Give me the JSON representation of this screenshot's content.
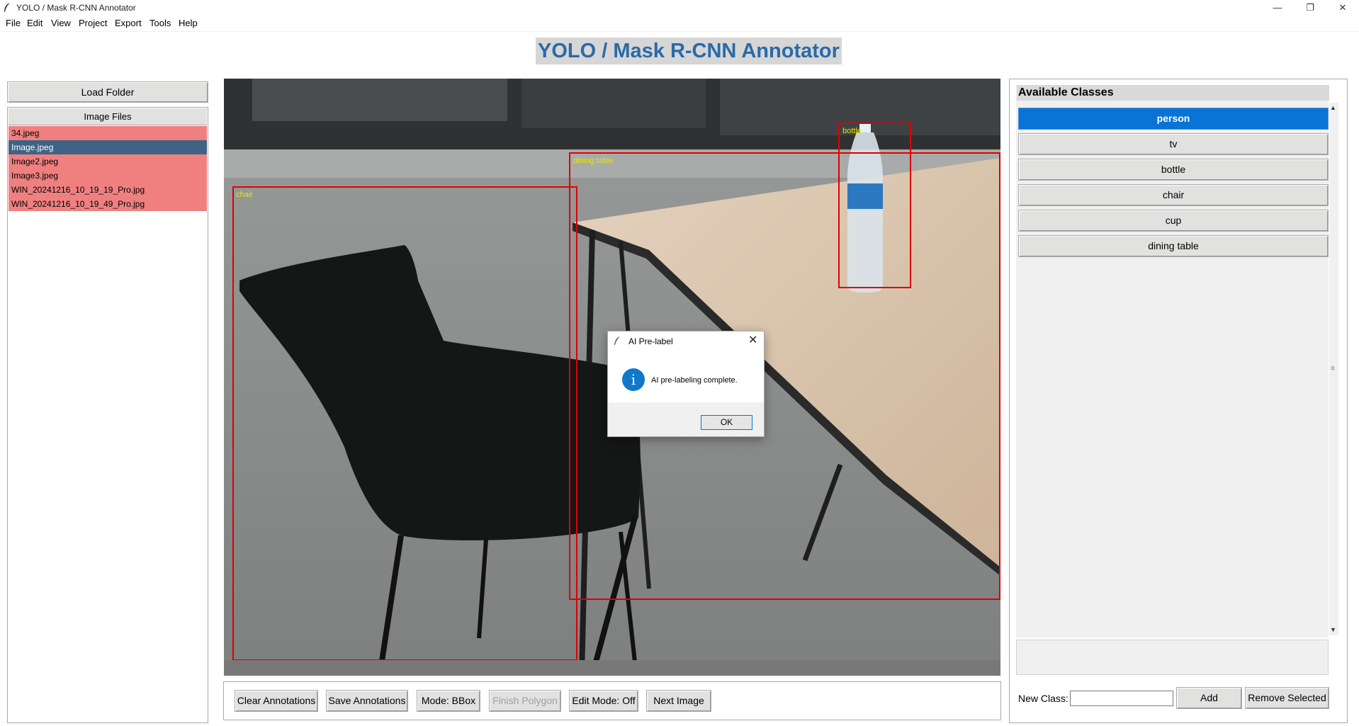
{
  "window": {
    "title": "YOLO / Mask R-CNN Annotator",
    "controls": [
      "—",
      "❐",
      "✕"
    ]
  },
  "menu": [
    "File",
    "Edit",
    "View",
    "Project",
    "Export",
    "Tools",
    "Help"
  ],
  "app_heading": "YOLO / Mask R-CNN Annotator",
  "left_panel": {
    "load_folder_label": "Load Folder",
    "files_header": "Image Files",
    "files": [
      "34.jpeg",
      "Image.jpeg",
      "Image2.jpeg",
      "Image3.jpeg",
      "WIN_20241216_10_19_19_Pro.jpg",
      "WIN_20241216_10_19_49_Pro.jpg"
    ],
    "selected_file": "Image.jpeg"
  },
  "canvas": {
    "annotations": [
      {
        "label": "chair"
      },
      {
        "label": "dining table"
      },
      {
        "label": "bottle"
      }
    ],
    "box_color": "#e00000",
    "label_color": "#e6e600"
  },
  "toolbar": {
    "clear": "Clear Annotations",
    "save": "Save Annotations",
    "mode": "Mode: BBox",
    "finish_polygon": "Finish Polygon",
    "edit_mode": "Edit Mode: Off",
    "next": "Next Image"
  },
  "right_panel": {
    "title": "Available Classes",
    "classes": [
      "person",
      "tv",
      "bottle",
      "chair",
      "cup",
      "dining table"
    ],
    "selected_class": "person",
    "new_class_label": "New Class:",
    "new_class_value": "",
    "add_label": "Add",
    "remove_label": "Remove Selected"
  },
  "dialog": {
    "title": "AI Pre-label",
    "message": "AI pre-labeling complete.",
    "ok_label": "OK",
    "icon": "info-icon"
  },
  "colors": {
    "file_row_bg": "#f08080",
    "file_selected_bg": "#3d6385",
    "class_selected_bg": "#0a74d6",
    "heading_color": "#2a6aa8"
  }
}
